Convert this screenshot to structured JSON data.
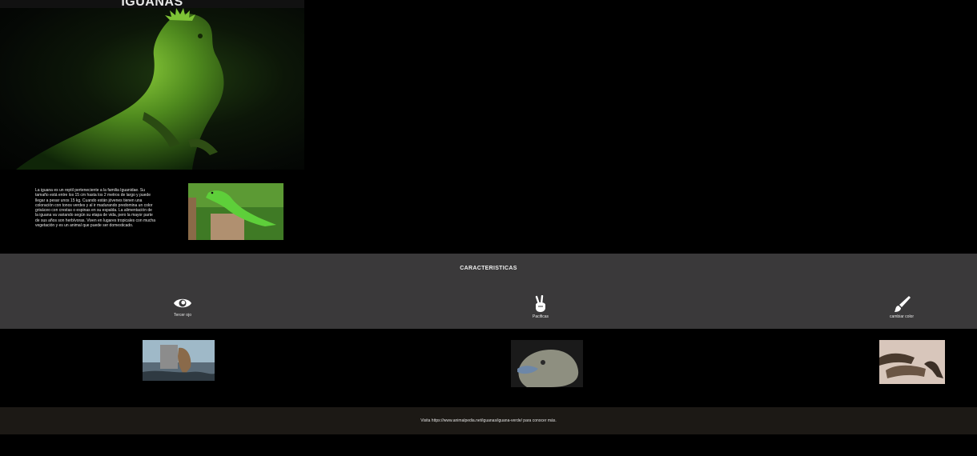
{
  "hero": {
    "title": "IGUANAS"
  },
  "intro": {
    "paragraph": "La iguana es un reptil perteneciente a la familia Iguanidae. Su tamaño está entre los 15 cm hasta los 2 metros de largo y puede llegar a pesar unos 15 kg. Cuando están jóvenes tienen una coloración con tonos verdes y al ir madurando predomina un color grisáceo con crestas o espinas en su espalda. La alimentación de la iguana va variando según su etapa de vida, pero la mayor parte de sus años son herbívoras. Viven en lugares tropicales con mucha vegetación y es un animal que puede ser domesticado."
  },
  "features": {
    "title": "CARACTERISTICAS",
    "items": [
      {
        "icon": "eye-icon",
        "label": "Tercer ojo"
      },
      {
        "icon": "peace-hand-icon",
        "label": "Pacificas"
      },
      {
        "icon": "paintbrush-icon",
        "label": "cambiar color"
      }
    ]
  },
  "footer": {
    "text": "Visita https://www.animalpedia.net/iguanas/iguana-verde/ para conocer más."
  },
  "colors": {
    "features_bg": "#3a393a",
    "footer_bg": "#1c1915",
    "page_bg": "#000000"
  }
}
